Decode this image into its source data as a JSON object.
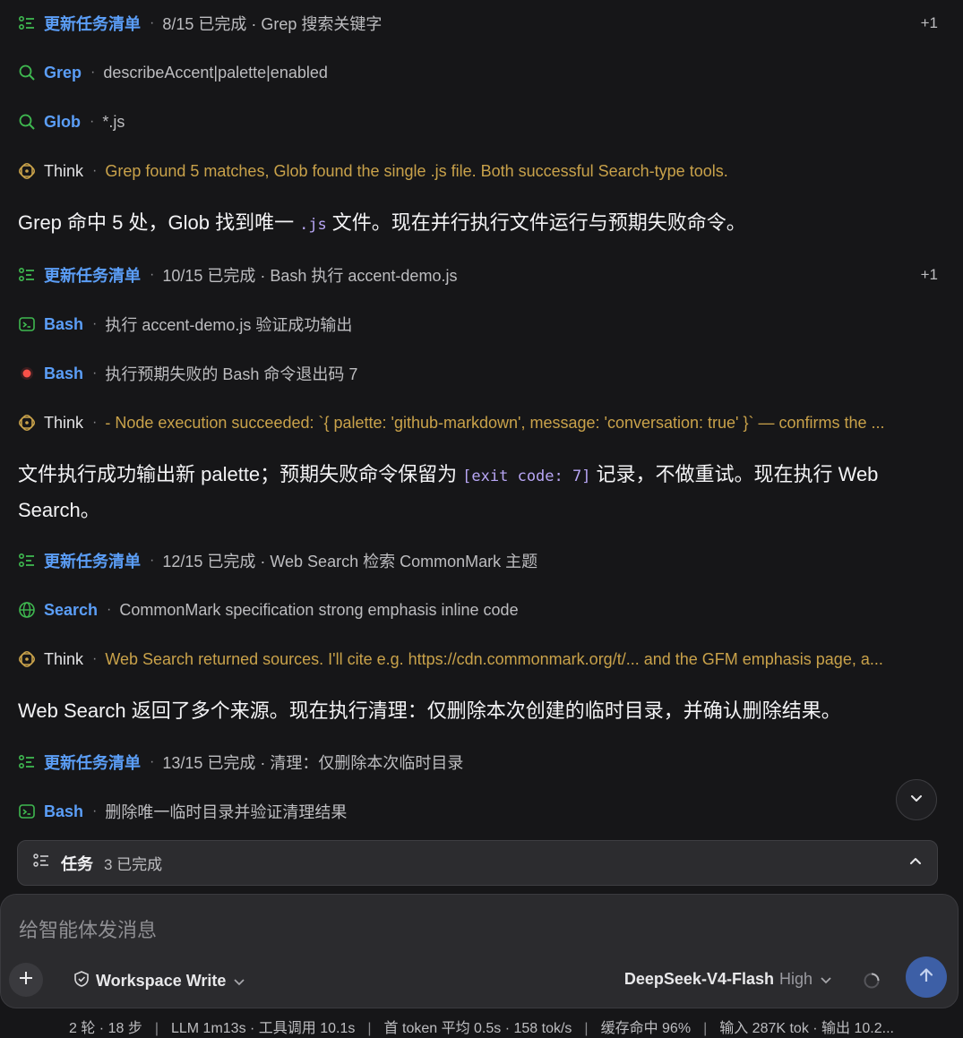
{
  "feed": {
    "rows": [
      {
        "kind": "todo",
        "tool": "更新任务清单",
        "desc": "8/15 已完成 · Grep 搜索关键字",
        "extra": "+1"
      },
      {
        "kind": "grep",
        "tool": "Grep",
        "desc": "describeAccent|palette|enabled"
      },
      {
        "kind": "glob",
        "tool": "Glob",
        "desc": "*.js"
      },
      {
        "kind": "think",
        "tool": "Think",
        "desc": "Grep found 5 matches, Glob found the single .js file. Both successful Search-type tools."
      },
      {
        "kind": "todo",
        "tool": "更新任务清单",
        "desc": "10/15 已完成 · Bash 执行 accent-demo.js",
        "extra": "+1"
      },
      {
        "kind": "bash",
        "tool": "Bash",
        "desc": "执行 accent-demo.js 验证成功输出"
      },
      {
        "kind": "bash-error",
        "tool": "Bash",
        "desc": "执行预期失败的 Bash 命令退出码 7"
      },
      {
        "kind": "think",
        "tool": "Think",
        "desc": "- Node execution succeeded: `{ palette: 'github-markdown', message: 'conversation: true' }` — confirms the ..."
      },
      {
        "kind": "todo",
        "tool": "更新任务清单",
        "desc": "12/15 已完成 · Web Search 检索 CommonMark 主题"
      },
      {
        "kind": "search",
        "tool": "Search",
        "desc": "CommonMark specification strong emphasis inline code"
      },
      {
        "kind": "think",
        "tool": "Think",
        "desc": "Web Search returned sources. I'll cite e.g. https://cdn.commonmark.org/t/... and the GFM emphasis page, a..."
      },
      {
        "kind": "todo",
        "tool": "更新任务清单",
        "desc": "13/15 已完成 · 清理：仅删除本次临时目录"
      },
      {
        "kind": "bash",
        "tool": "Bash",
        "desc": "删除唯一临时目录并验证清理结果"
      }
    ],
    "messages": [
      {
        "before": "Grep 命中 5 处，Glob 找到唯一",
        "code": ".js",
        "after": "文件。现在并行执行文件运行与预期失败命令。"
      },
      {
        "before": "文件执行成功输出新 palette；预期失败命令保留为",
        "code": "[exit code: 7]",
        "after": "记录，不做重试。现在执行 Web Search。"
      },
      {
        "before": "Web Search 返回了多个来源。现在执行清理：仅删除本次创建的临时目录，并确认删除结果。",
        "code": "",
        "after": ""
      }
    ]
  },
  "tasks_panel": {
    "title": "任务",
    "count": "3 已完成"
  },
  "composer": {
    "placeholder": "给智能体发消息",
    "permission": "Workspace Write",
    "model": "DeepSeek-V4-Flash",
    "level": "High"
  },
  "stats": {
    "turns": "2 轮 · 18 步",
    "llm": "LLM 1m13s · 工具调用 10.1s",
    "first_token": "首 token 平均 0.5s · 158 tok/s",
    "cache": "缓存命中 96%",
    "io": "输入 287K tok · 输出 10.2..."
  },
  "colors": {
    "tool": "#5b9ef7",
    "think": "#c9a24a",
    "icon_green": "#3fb950",
    "error_red": "#f85149",
    "code": "#b8a6f5",
    "send": "#3d5fa6"
  },
  "icons": {
    "todo": "list-check-icon",
    "grep": "search-icon",
    "glob": "search-icon",
    "think": "brain-icon",
    "bash": "terminal-icon",
    "bash-error": "error-dot-icon",
    "search": "globe-icon"
  }
}
